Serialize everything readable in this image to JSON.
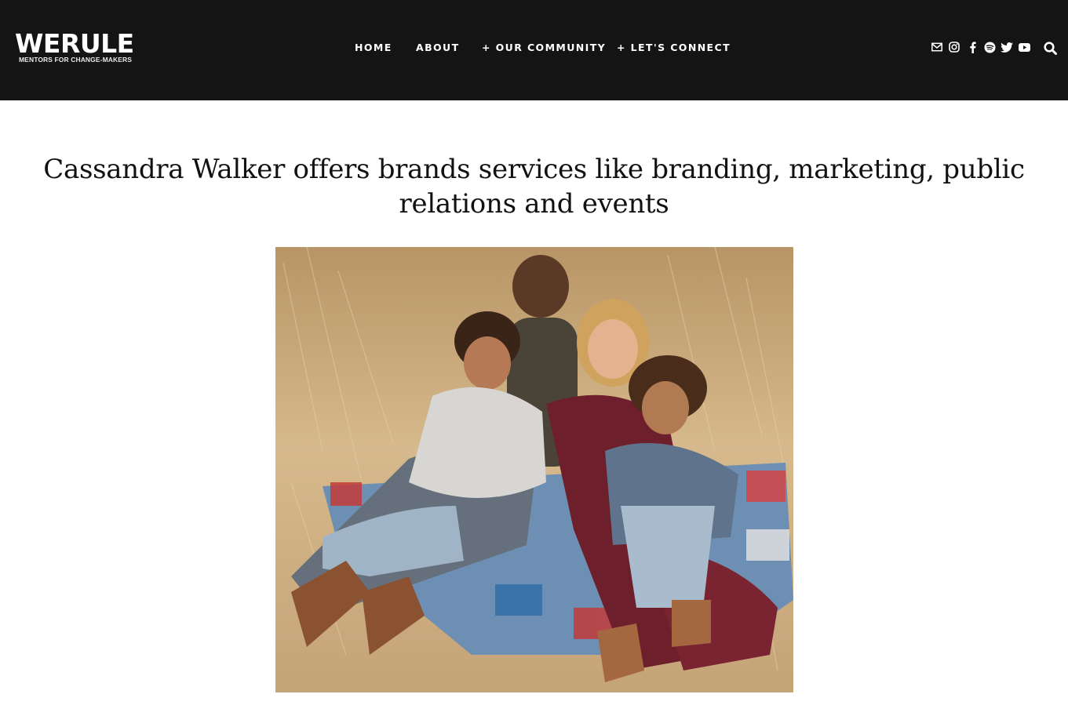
{
  "header": {
    "logo": {
      "title": "WERULE",
      "tagline": "MENTORS FOR CHANGE-MAKERS"
    },
    "nav": [
      {
        "label": "HOME"
      },
      {
        "label": "ABOUT"
      },
      {
        "label": "+ OUR COMMUNITY"
      },
      {
        "label": "+ LET'S CONNECT"
      }
    ],
    "social_icons": [
      "mail-icon",
      "instagram-icon",
      "facebook-icon",
      "spotify-icon",
      "twitter-icon",
      "youtube-icon"
    ],
    "search_icon": "search-icon",
    "background_color": "#141414"
  },
  "article": {
    "headline": "Cassandra Walker offers brands services like branding, marketing, public relations and events"
  }
}
